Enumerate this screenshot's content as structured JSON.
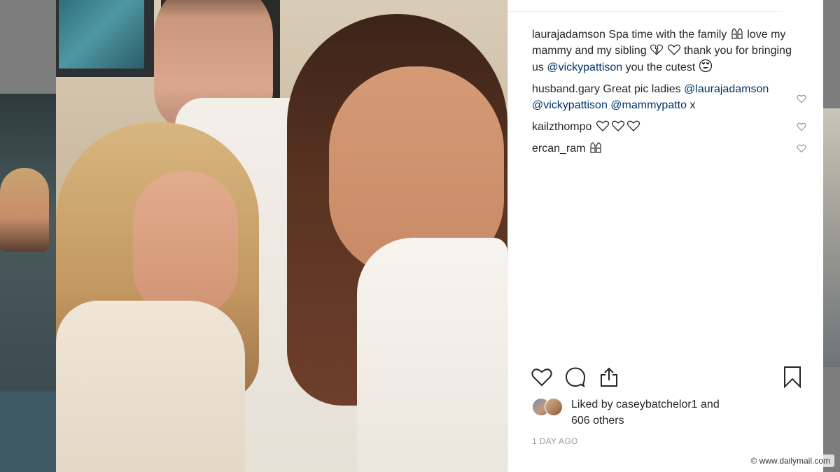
{
  "post": {
    "caption_user": "laurajadamson",
    "caption_text_1": "Spa time with the family",
    "caption_text_2": "love my mammy and my sibling",
    "caption_text_3": "thank you for bringing us",
    "caption_mention": "@vickypattison",
    "caption_text_4": "you the cutest"
  },
  "comments": [
    {
      "user": "husband.gary",
      "text": "Great pic ladies",
      "mention_1": "@laurajadamson",
      "mention_2": "@vickypattison",
      "mention_3": "@mammypatto",
      "tail": "x"
    },
    {
      "user": "kailzthompo"
    },
    {
      "user": "ercan_ram"
    }
  ],
  "likes": {
    "prefix": "Liked by",
    "user": "caseybatchelor1",
    "and": "and",
    "others": "606 others"
  },
  "timestamp": "1 DAY AGO",
  "watermark": "© www.dailymail.com",
  "colors": {
    "text": "#262626",
    "mention": "#003569",
    "meta": "#999999"
  },
  "icons": [
    "heart-icon",
    "comment-icon",
    "share-icon",
    "bookmark-icon",
    "heart-small-icon",
    "raised-hands-emoji",
    "broken-heart-emoji",
    "white-heart-emoji",
    "heart-eyes-emoji"
  ]
}
